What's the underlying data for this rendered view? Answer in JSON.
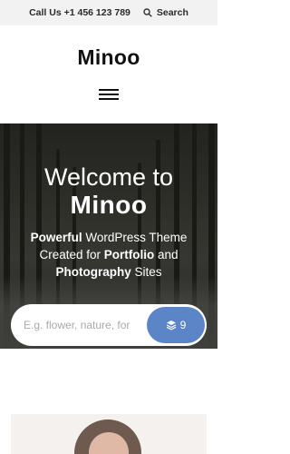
{
  "topbar": {
    "phone": "Call Us +1 456 123 789",
    "search_label": "Search"
  },
  "header": {
    "logo": "Minoo"
  },
  "hero": {
    "welcome": "Welcome to",
    "brand": "Minoo",
    "tagline_part1": "Powerful",
    "tagline_part2": " WordPress Theme Created for ",
    "tagline_part3": "Portfolio",
    "tagline_part4": " and ",
    "tagline_part5": "Photography",
    "tagline_part6": " Sites"
  },
  "search": {
    "placeholder": "E.g. flower, nature, for",
    "count": "9"
  },
  "colors": {
    "accent": "#5b85c7",
    "topbar_bg": "#f2f2f2"
  },
  "icons": {
    "search": "search-icon",
    "menu": "hamburger-menu-icon",
    "layers": "layers-icon"
  }
}
